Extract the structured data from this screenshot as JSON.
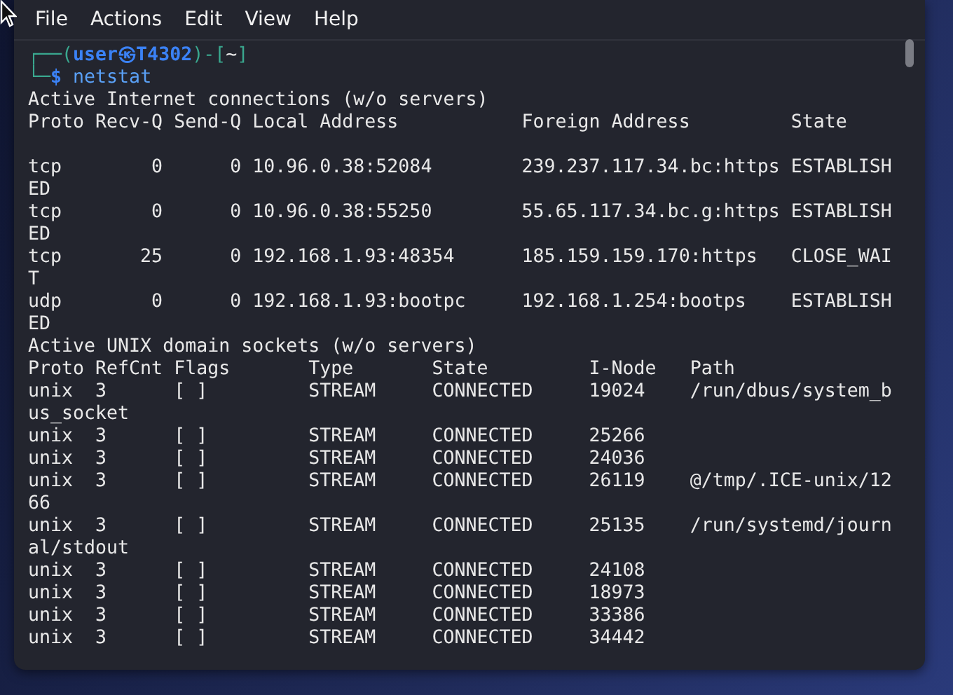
{
  "menu": [
    "File",
    "Actions",
    "Edit",
    "View",
    "Help"
  ],
  "prompt": [
    [
      {
        "text": "┌──(",
        "kind": "frame"
      },
      {
        "text": "user㉿T4302",
        "kind": "user"
      },
      {
        "text": ")-[",
        "kind": "frame"
      },
      {
        "text": "~",
        "kind": "dir"
      },
      {
        "text": "]",
        "kind": "frame"
      }
    ],
    [
      {
        "text": "└─",
        "kind": "frame"
      },
      {
        "text": "$ ",
        "kind": "user"
      },
      {
        "text": "netstat",
        "kind": "command"
      }
    ]
  ],
  "output": [
    {
      "kind": "text",
      "text": "Active Internet connections (w/o servers)"
    },
    {
      "kind": "text",
      "text": "Proto Recv-Q Send-Q Local Address           Foreign Address         State"
    },
    {
      "kind": "blank"
    },
    {
      "kind": "text",
      "text": "tcp        0      0 10.96.0.38:52084        239.237.117.34.bc:https ESTABLISH"
    },
    {
      "kind": "text",
      "text": "ED"
    },
    {
      "kind": "text",
      "text": "tcp        0      0 10.96.0.38:55250        55.65.117.34.bc.g:https ESTABLISH"
    },
    {
      "kind": "text",
      "text": "ED"
    },
    {
      "kind": "text",
      "text": "tcp       25      0 192.168.1.93:48354      185.159.159.170:https   CLOSE_WAI"
    },
    {
      "kind": "text",
      "text": "T"
    },
    {
      "kind": "text",
      "text": "udp        0      0 192.168.1.93:bootpc     192.168.1.254:bootps    ESTABLISH"
    },
    {
      "kind": "text",
      "text": "ED"
    },
    {
      "kind": "text",
      "text": "Active UNIX domain sockets (w/o servers)"
    },
    {
      "kind": "text",
      "text": "Proto RefCnt Flags       Type       State         I-Node   Path"
    },
    {
      "kind": "text",
      "text": "unix  3      [ ]         STREAM     CONNECTED     19024    /run/dbus/system_b"
    },
    {
      "kind": "text",
      "text": "us_socket"
    },
    {
      "kind": "text",
      "text": "unix  3      [ ]         STREAM     CONNECTED     25266"
    },
    {
      "kind": "text",
      "text": "unix  3      [ ]         STREAM     CONNECTED     24036"
    },
    {
      "kind": "text",
      "text": "unix  3      [ ]         STREAM     CONNECTED     26119    @/tmp/.ICE-unix/12"
    },
    {
      "kind": "text",
      "text": "66"
    },
    {
      "kind": "text",
      "text": "unix  3      [ ]         STREAM     CONNECTED     25135    /run/systemd/journ"
    },
    {
      "kind": "text",
      "text": "al/stdout"
    },
    {
      "kind": "text",
      "text": "unix  3      [ ]         STREAM     CONNECTED     24108"
    },
    {
      "kind": "text",
      "text": "unix  3      [ ]         STREAM     CONNECTED     18973"
    },
    {
      "kind": "text",
      "text": "unix  3      [ ]         STREAM     CONNECTED     33386"
    },
    {
      "kind": "text",
      "text": "unix  3      [ ]         STREAM     CONNECTED     34442"
    }
  ]
}
